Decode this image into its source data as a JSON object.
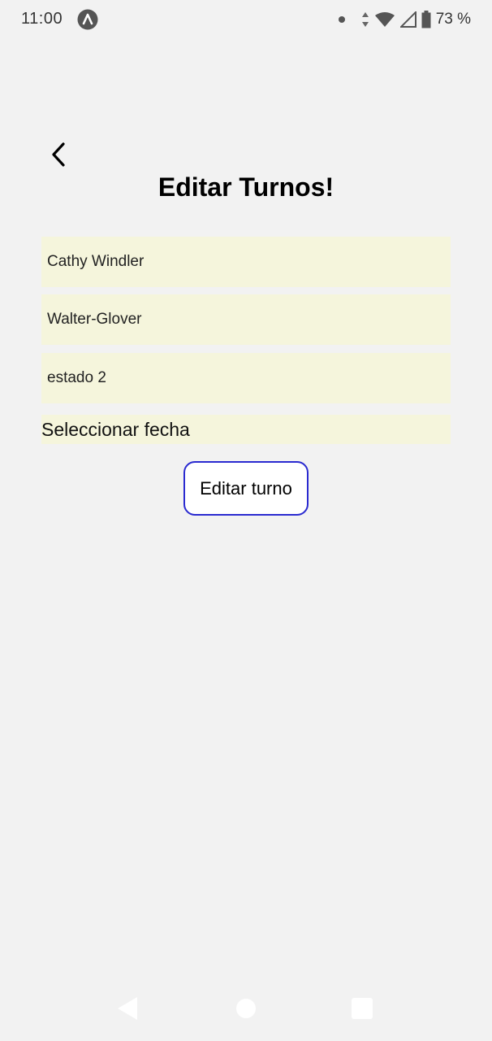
{
  "status_bar": {
    "time": "11:00",
    "battery": "73 %",
    "icons": [
      "app-notification-icon",
      "dot-icon",
      "data-arrows-icon",
      "wifi-icon",
      "cell-signal-icon",
      "battery-icon"
    ]
  },
  "header": {
    "back_icon": "chevron-left-icon",
    "title": "Editar Turnos!"
  },
  "form": {
    "field_1_value": "Cathy Windler",
    "field_2_value": "Walter-Glover",
    "field_3_value": "estado 2",
    "date_label": "Seleccionar fecha",
    "submit_label": "Editar turno",
    "field_background": "#f5f5dc",
    "button_border": "#2a2ad0"
  },
  "nav_bar": {
    "icons": [
      "nav-back-icon",
      "nav-home-icon",
      "nav-recents-icon"
    ]
  }
}
